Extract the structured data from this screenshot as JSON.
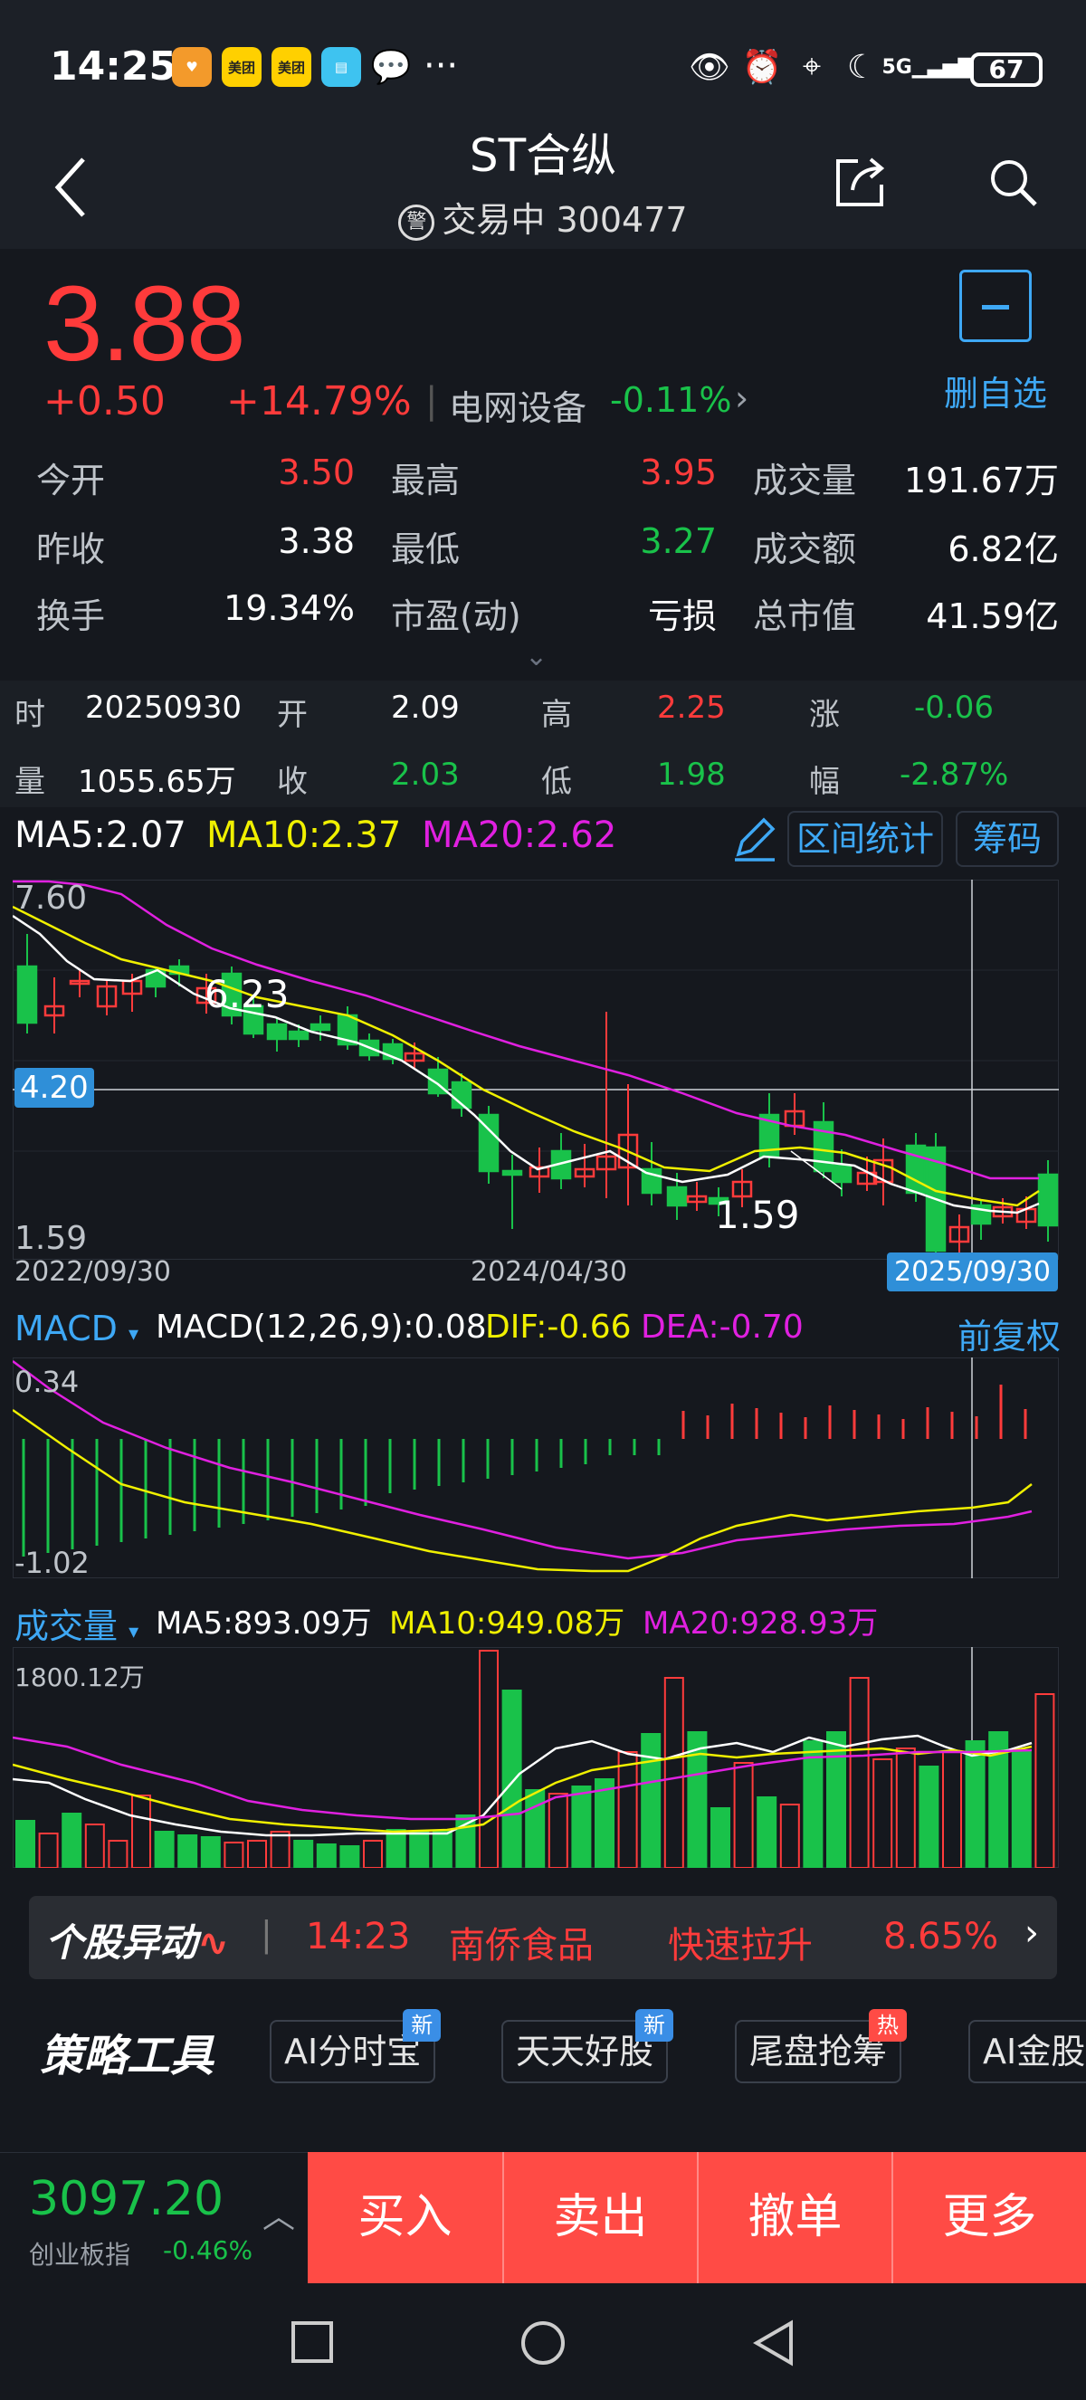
{
  "status_bar": {
    "time": "14:25",
    "apps": [
      "美团",
      "美团"
    ],
    "dots": "···",
    "network": "5G",
    "battery": "67"
  },
  "header": {
    "title": "ST合纵",
    "badge": "警",
    "subtitle": "交易中 300477"
  },
  "quote": {
    "price": "3.88",
    "change": "+0.50",
    "change_pct": "+14.79%",
    "sector": "电网设备",
    "sector_change": "-0.11%",
    "watch_label": "删自选",
    "stats": [
      {
        "label": "今开",
        "value": "3.50",
        "color": "red"
      },
      {
        "label": "最高",
        "value": "3.95",
        "color": "red"
      },
      {
        "label": "成交量",
        "value": "191.67万",
        "color": "white"
      },
      {
        "label": "昨收",
        "value": "3.38",
        "color": "white"
      },
      {
        "label": "最低",
        "value": "3.27",
        "color": "green"
      },
      {
        "label": "成交额",
        "value": "6.82亿",
        "color": "white"
      },
      {
        "label": "换手",
        "value": "19.34%",
        "color": "white"
      },
      {
        "label": "市盈(动)",
        "value": "亏损",
        "color": "white"
      },
      {
        "label": "总市值",
        "value": "41.59亿",
        "color": "white"
      }
    ]
  },
  "detail": {
    "time_label": "时",
    "time_value": "20250930",
    "open_label": "开",
    "open_value": "2.09",
    "high_label": "高",
    "high_value": "2.25",
    "change_label": "涨",
    "change_value": "-0.06",
    "vol_label": "量",
    "vol_value": "1055.65万",
    "close_label": "收",
    "close_value": "2.03",
    "low_label": "低",
    "low_value": "1.98",
    "pct_label": "幅",
    "pct_value": "-2.87%"
  },
  "kline": {
    "ma5": "MA5:2.07",
    "ma10": "MA10:2.37",
    "ma20": "MA20:2.62",
    "range_stats_label": "区间统计",
    "chips_label": "筹码",
    "y_max": "7.60",
    "y_min": "1.59",
    "cross_price": "4.20",
    "peak_label": "6.23",
    "low_label": "1.59",
    "date_start": "2022/09/30",
    "date_mid": "2024/04/30",
    "date_end": "2025/09/30",
    "colors": {
      "up": "#ff3b3b",
      "down": "#19c24a",
      "ma5": "#ffffff",
      "ma10": "#f0f000",
      "ma20": "#e020e0"
    }
  },
  "macd": {
    "name": "MACD",
    "params": "MACD(12,26,9):0.08",
    "dif": "DIF:-0.66",
    "dea": "DEA:-0.70",
    "adjust_label": "前复权",
    "y_max": "0.34",
    "y_min": "-1.02"
  },
  "volume": {
    "name": "成交量",
    "ma5": "MA5:893.09万",
    "ma10": "MA10:949.08万",
    "ma20": "MA20:928.93万",
    "y_max": "1800.12万"
  },
  "news": {
    "brand": "个股异动",
    "time": "14:23",
    "stock": "南侨食品",
    "event": "快速拉升",
    "pct": "8.65%"
  },
  "tools": {
    "brand": "策略工具",
    "items": [
      {
        "label": "AI分时宝",
        "tag": "新"
      },
      {
        "label": "天天好股",
        "tag": "新"
      },
      {
        "label": "尾盘抢筹",
        "tag": "热"
      },
      {
        "label": "AI金股",
        "tag": ""
      }
    ]
  },
  "bottom": {
    "index_value": "3097.20",
    "index_name": "创业板指",
    "index_change": "-0.46%",
    "buttons": [
      "买入",
      "卖出",
      "撤单",
      "更多"
    ]
  }
}
